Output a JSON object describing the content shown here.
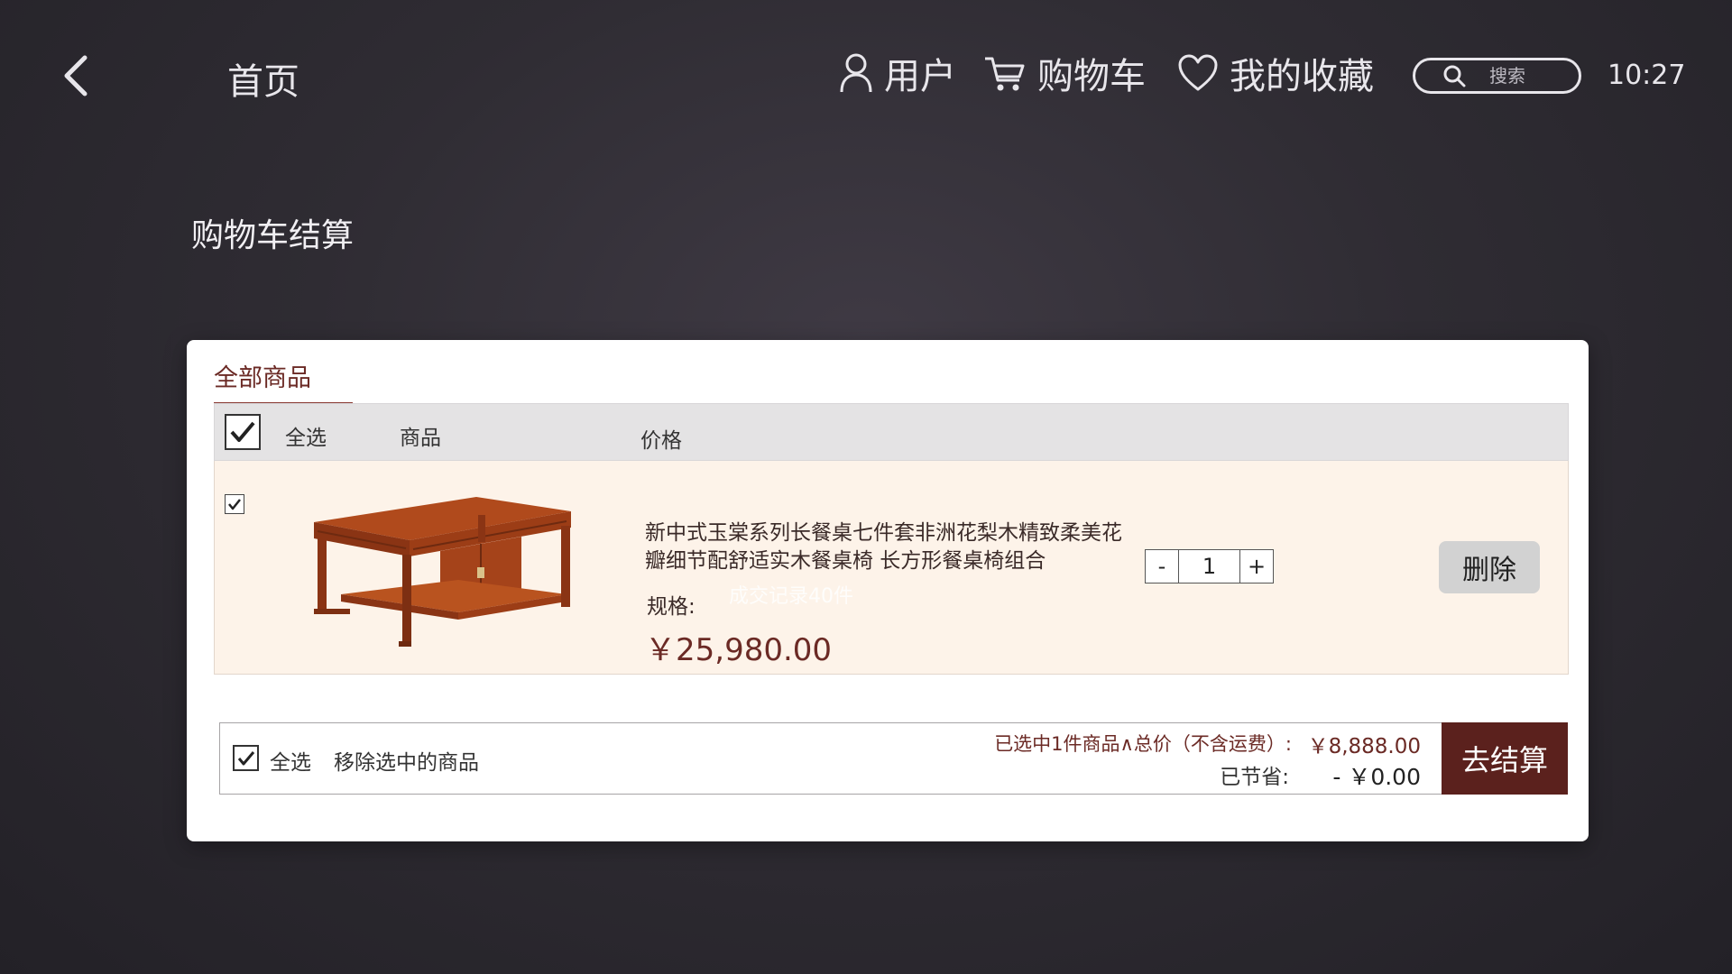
{
  "header": {
    "home": "首页",
    "nav": {
      "user": "用户",
      "cart": "购物车",
      "favorites": "我的收藏"
    },
    "search_placeholder": "搜索",
    "time": "10:27"
  },
  "page_title": "购物车结算",
  "panel": {
    "tab_all": "全部商品",
    "columns": {
      "select_all": "全选",
      "product": "商品",
      "price": "价格"
    },
    "item": {
      "selected": true,
      "name": "新中式玉棠系列长餐桌七件套非洲花梨木精致柔美花瓣细节配舒适实木餐桌椅 长方形餐桌椅组合",
      "spec_label": "规格:",
      "sold": "成交记录40件",
      "price": "￥25,980.00",
      "qty_minus": "-",
      "quantity": "1",
      "qty_plus": "+",
      "delete": "删除"
    },
    "footer": {
      "select_all": "全选",
      "remove_selected": "移除选中的商品",
      "summary_label": "已选中1件商品∧总价（不含运费）:",
      "summary_value": "￥8,888.00",
      "saved_label": "已节省:",
      "saved_value": "- ￥0.00",
      "checkout": "去结算"
    }
  },
  "colors": {
    "accent": "#5b211d",
    "price_text": "#6b2a25",
    "row_bg": "#fdf3e9"
  },
  "icons": [
    "chevron-left-icon",
    "user-icon",
    "cart-icon",
    "heart-icon",
    "search-icon",
    "check-icon"
  ]
}
